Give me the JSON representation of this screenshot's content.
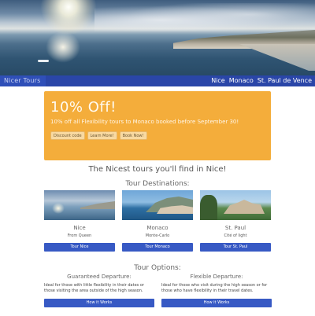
{
  "navbar": {
    "brand": "Nicer Tours",
    "links": [
      "Nice",
      "Monaco",
      "St. Paul de Vence"
    ]
  },
  "promo": {
    "title": "10% Off!",
    "text": "10% off all Flexibility tours to Monaco booked before September 30!",
    "buttons": [
      "Discount code",
      "Learn More!",
      "Book Now!"
    ]
  },
  "headline": "The Nicest tours you'll find in Nice!",
  "destinations": {
    "heading": "Tour Destinations:",
    "items": [
      {
        "name": "Nice",
        "desc": "From Queen",
        "button": "Tour Nice"
      },
      {
        "name": "Monaco",
        "desc": "Monte-Carlo",
        "button": "Tour Monaco"
      },
      {
        "name": "St. Paul",
        "desc": "Cité of light",
        "button": "Tour St. Paul"
      }
    ]
  },
  "options": {
    "heading": "Tour Options:",
    "items": [
      {
        "title": "Guaranteed Departure:",
        "text": "Ideal for those with little flexibility in their dates or those visiting the area outside of the high season.",
        "button": "How it Works"
      },
      {
        "title": "Flexible Departure:",
        "text": "Ideal for those who visit during the high season or for those who have flexibility in their travel dates.",
        "button": "How it Works"
      }
    ]
  },
  "colors": {
    "nav": "#2a46a8",
    "promo": "#f4ad3b",
    "button": "#3759c4"
  }
}
